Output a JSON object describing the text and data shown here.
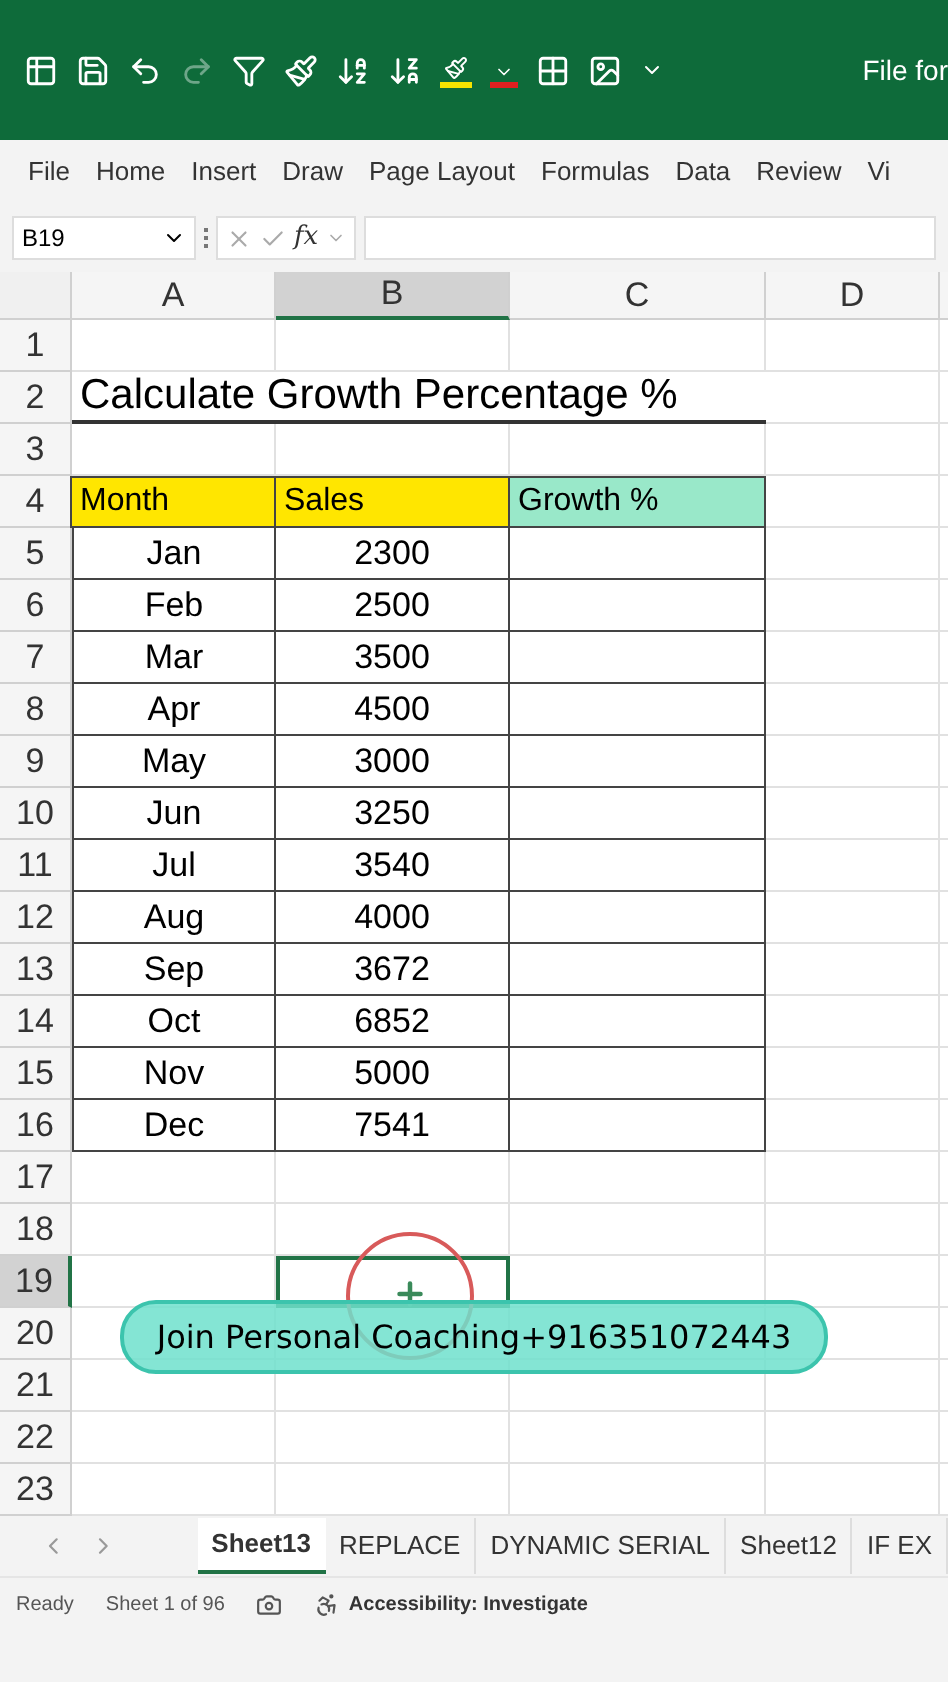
{
  "title_bar": {
    "title": "File for"
  },
  "ribbon_tabs": [
    {
      "label": "File",
      "selected": false
    },
    {
      "label": "Home",
      "selected": false
    },
    {
      "label": "Insert",
      "selected": false
    },
    {
      "label": "Draw",
      "selected": false
    },
    {
      "label": "Page Layout",
      "selected": false
    },
    {
      "label": "Formulas",
      "selected": false
    },
    {
      "label": "Data",
      "selected": false
    },
    {
      "label": "Review",
      "selected": false
    },
    {
      "label": "Vi",
      "selected": false
    }
  ],
  "name_box": "B19",
  "fx": "fx",
  "columns": [
    {
      "label": "A",
      "selected": false
    },
    {
      "label": "B",
      "selected": true
    },
    {
      "label": "C",
      "selected": false
    },
    {
      "label": "D",
      "selected": false
    }
  ],
  "row_numbers": [
    {
      "label": "1",
      "selected": false
    },
    {
      "label": "2",
      "selected": false
    },
    {
      "label": "3",
      "selected": false
    },
    {
      "label": "4",
      "selected": false
    },
    {
      "label": "5",
      "selected": false
    },
    {
      "label": "6",
      "selected": false
    },
    {
      "label": "7",
      "selected": false
    },
    {
      "label": "8",
      "selected": false
    },
    {
      "label": "9",
      "selected": false
    },
    {
      "label": "10",
      "selected": false
    },
    {
      "label": "11",
      "selected": false
    },
    {
      "label": "12",
      "selected": false
    },
    {
      "label": "13",
      "selected": false
    },
    {
      "label": "14",
      "selected": false
    },
    {
      "label": "15",
      "selected": false
    },
    {
      "label": "16",
      "selected": false
    },
    {
      "label": "17",
      "selected": false
    },
    {
      "label": "18",
      "selected": false
    },
    {
      "label": "19",
      "selected": true
    },
    {
      "label": "20",
      "selected": false
    },
    {
      "label": "21",
      "selected": false
    },
    {
      "label": "22",
      "selected": false
    },
    {
      "label": "23",
      "selected": false
    }
  ],
  "sheet_title": "Calculate Growth Percentage %",
  "table": {
    "headers": [
      {
        "label": "Month",
        "color": "#ffe600"
      },
      {
        "label": "Sales",
        "color": "#ffe600"
      },
      {
        "label": "Growth %",
        "color": "#99e8c9"
      }
    ],
    "rows": [
      {
        "month": "Jan",
        "sales": "2300"
      },
      {
        "month": "Feb",
        "sales": "2500"
      },
      {
        "month": "Mar",
        "sales": "3500"
      },
      {
        "month": "Apr",
        "sales": "4500"
      },
      {
        "month": "May",
        "sales": "3000"
      },
      {
        "month": "Jun",
        "sales": "3250"
      },
      {
        "month": "Jul",
        "sales": "3540"
      },
      {
        "month": "Aug",
        "sales": "4000"
      },
      {
        "month": "Sep",
        "sales": "3672"
      },
      {
        "month": "Oct",
        "sales": "6852"
      },
      {
        "month": "Nov",
        "sales": "5000"
      },
      {
        "month": "Dec",
        "sales": "7541"
      }
    ]
  },
  "sheet_tabs": [
    {
      "label": "Sheet13",
      "selected": true
    },
    {
      "label": "REPLACE",
      "selected": false
    },
    {
      "label": "DYNAMIC SERIAL",
      "selected": false
    },
    {
      "label": "Sheet12",
      "selected": false
    },
    {
      "label": "IF EX",
      "selected": false
    }
  ],
  "status_bar": {
    "ready": "Ready",
    "sheet_count": "Sheet 1 of 96",
    "accessibility": "Accessibility: Investigate"
  },
  "banner": "Join Personal Coaching+916351072443"
}
